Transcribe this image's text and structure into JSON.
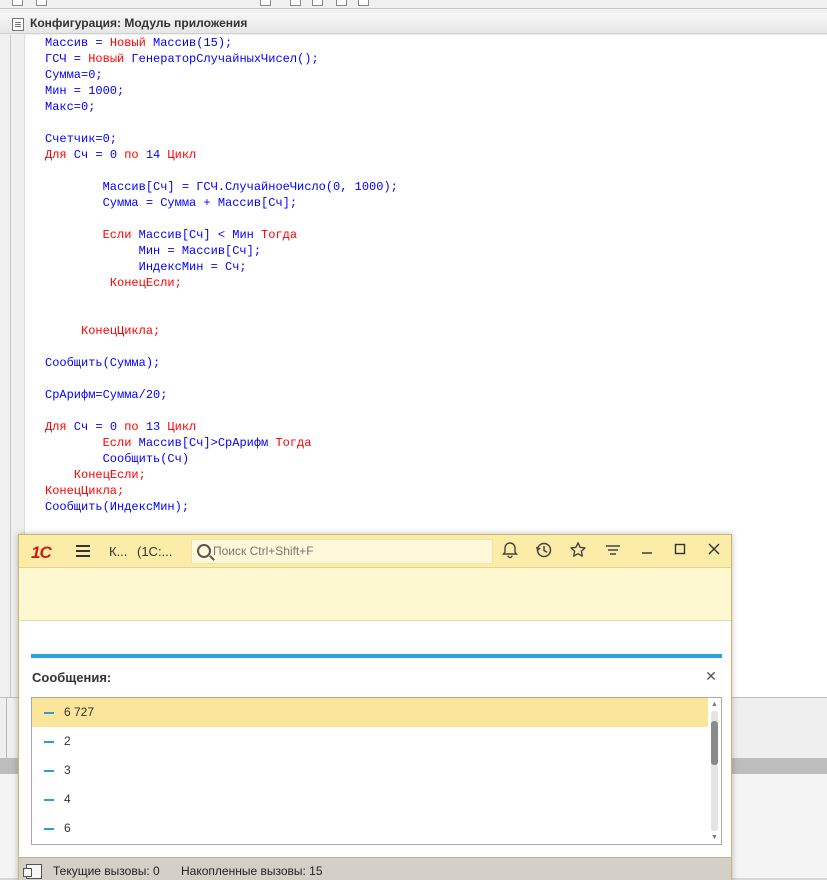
{
  "config_window": {
    "title": "Конфигурация: Модуль приложения"
  },
  "code_lines": [
    [
      {
        "t": "Массив = ",
        "c": "b"
      },
      {
        "t": "Новый",
        "c": "r"
      },
      {
        "t": " Массив(15);",
        "c": "b"
      }
    ],
    [
      {
        "t": "ГСЧ = ",
        "c": "b"
      },
      {
        "t": "Новый",
        "c": "r"
      },
      {
        "t": " ГенераторСлучайныхЧисел();",
        "c": "b"
      }
    ],
    [
      {
        "t": "Сумма=0;",
        "c": "b"
      }
    ],
    [
      {
        "t": "Мин = 1000;",
        "c": "b"
      }
    ],
    [
      {
        "t": "Макс=0;",
        "c": "b"
      }
    ],
    [],
    [
      {
        "t": "Счетчик=0;",
        "c": "b"
      }
    ],
    [
      {
        "t": "Для",
        "c": "r"
      },
      {
        "t": " Сч = 0 ",
        "c": "b"
      },
      {
        "t": "по",
        "c": "r"
      },
      {
        "t": " 14 ",
        "c": "b"
      },
      {
        "t": "Цикл",
        "c": "r"
      }
    ],
    [],
    [
      {
        "t": "        Массив[Сч] = ГСЧ.СлучайноеЧисло(0, 1000);",
        "c": "b"
      }
    ],
    [
      {
        "t": "        Сумма = Сумма + Массив[Сч];",
        "c": "b"
      }
    ],
    [],
    [
      {
        "t": "        ",
        "c": "b"
      },
      {
        "t": "Если",
        "c": "r"
      },
      {
        "t": " Массив[Сч] < Мин ",
        "c": "b"
      },
      {
        "t": "Тогда",
        "c": "r"
      }
    ],
    [
      {
        "t": "             Мин = Массив[Сч];",
        "c": "b"
      }
    ],
    [
      {
        "t": "             ИндексМин = Сч;",
        "c": "b"
      }
    ],
    [
      {
        "t": "         ",
        "c": "b"
      },
      {
        "t": "КонецЕсли;",
        "c": "r"
      }
    ],
    [],
    [],
    [
      {
        "t": "     ",
        "c": "b"
      },
      {
        "t": "КонецЦикла;",
        "c": "r"
      }
    ],
    [],
    [
      {
        "t": "Сообщить(Сумма);",
        "c": "b"
      }
    ],
    [],
    [
      {
        "t": "СрАрифм=Сумма/20;",
        "c": "b"
      }
    ],
    [],
    [
      {
        "t": "Для",
        "c": "r"
      },
      {
        "t": " Сч = 0 ",
        "c": "b"
      },
      {
        "t": "по",
        "c": "r"
      },
      {
        "t": " 13 ",
        "c": "b"
      },
      {
        "t": "Цикл",
        "c": "r"
      }
    ],
    [
      {
        "t": "        ",
        "c": "b"
      },
      {
        "t": "Если",
        "c": "r"
      },
      {
        "t": " Массив[Сч]>СрАрифм ",
        "c": "b"
      },
      {
        "t": "Тогда",
        "c": "r"
      }
    ],
    [
      {
        "t": "        Сообщить(Сч)",
        "c": "b"
      }
    ],
    [
      {
        "t": "    ",
        "c": "b"
      },
      {
        "t": "КонецЕсли;",
        "c": "r"
      }
    ],
    [
      {
        "t": "КонецЦикла;",
        "c": "r"
      }
    ],
    [
      {
        "t": "Сообщить(ИндексМин);",
        "c": "b"
      }
    ]
  ],
  "app": {
    "logo": "1С",
    "title_short": "К...",
    "title_app": "(1С:...",
    "search_placeholder": "Поиск Ctrl+Shift+F",
    "icons": {
      "bell": "bell-icon",
      "history": "history-icon",
      "star": "star-icon",
      "menu": "settings-menu-icon",
      "minimize": "minimize-icon",
      "maximize": "maximize-icon",
      "close": "close-icon"
    }
  },
  "messages": {
    "title": "Сообщения:",
    "items": [
      "6 727",
      "2",
      "3",
      "4",
      "6"
    ],
    "selected_index": 0
  },
  "status": {
    "current_calls": "Текущие вызовы: 0",
    "accumulated_calls": "Накопленные вызовы: 15"
  },
  "colors": {
    "keyword": "#ff0000",
    "identifier": "#0000ff",
    "header_bg": "#fbeda8",
    "accent_blue": "#29a3dc",
    "selected_row": "#fbe59a"
  }
}
